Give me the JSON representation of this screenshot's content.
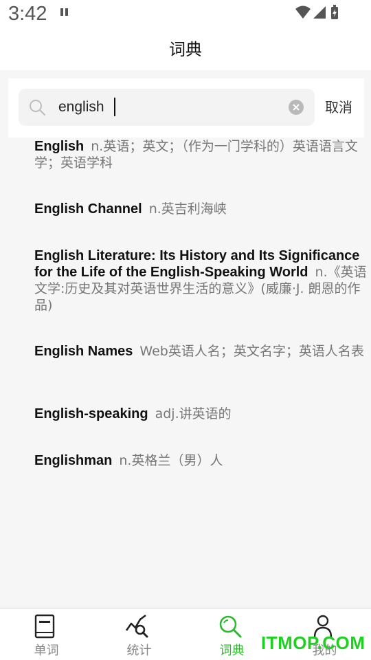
{
  "status_bar": {
    "time": "3:42"
  },
  "header": {
    "title": "词典"
  },
  "search": {
    "value": "english",
    "cancel_label": "取消"
  },
  "results": [
    {
      "word": "English",
      "definition": "n.英语；英文；（作为一门学科的）英语语言文学；英语学科"
    },
    {
      "word": "English Channel",
      "definition": "n.英吉利海峡"
    },
    {
      "word": "English Literature: Its History and Its Significance for the Life of the English-Speaking World",
      "definition": "n.《英语文学:历史及其对英语世界生活的意义》(威廉·J. 朗恩的作品)"
    },
    {
      "word": "English Names",
      "definition": "Web英语人名；英文名字；英语人名表"
    },
    {
      "word": "English-speaking",
      "definition": "adj.讲英语的"
    },
    {
      "word": "Englishman",
      "definition": "n.英格兰（男）人"
    }
  ],
  "tabs": [
    {
      "label": "单词",
      "icon": "book-icon"
    },
    {
      "label": "统计",
      "icon": "stats-icon"
    },
    {
      "label": "词典",
      "icon": "search-icon"
    },
    {
      "label": "我的",
      "icon": "person-icon"
    }
  ],
  "active_tab_index": 2,
  "watermark": "ITMOP.COM",
  "colors": {
    "accent": "#2fb72f",
    "watermark": "#1fd11f"
  }
}
